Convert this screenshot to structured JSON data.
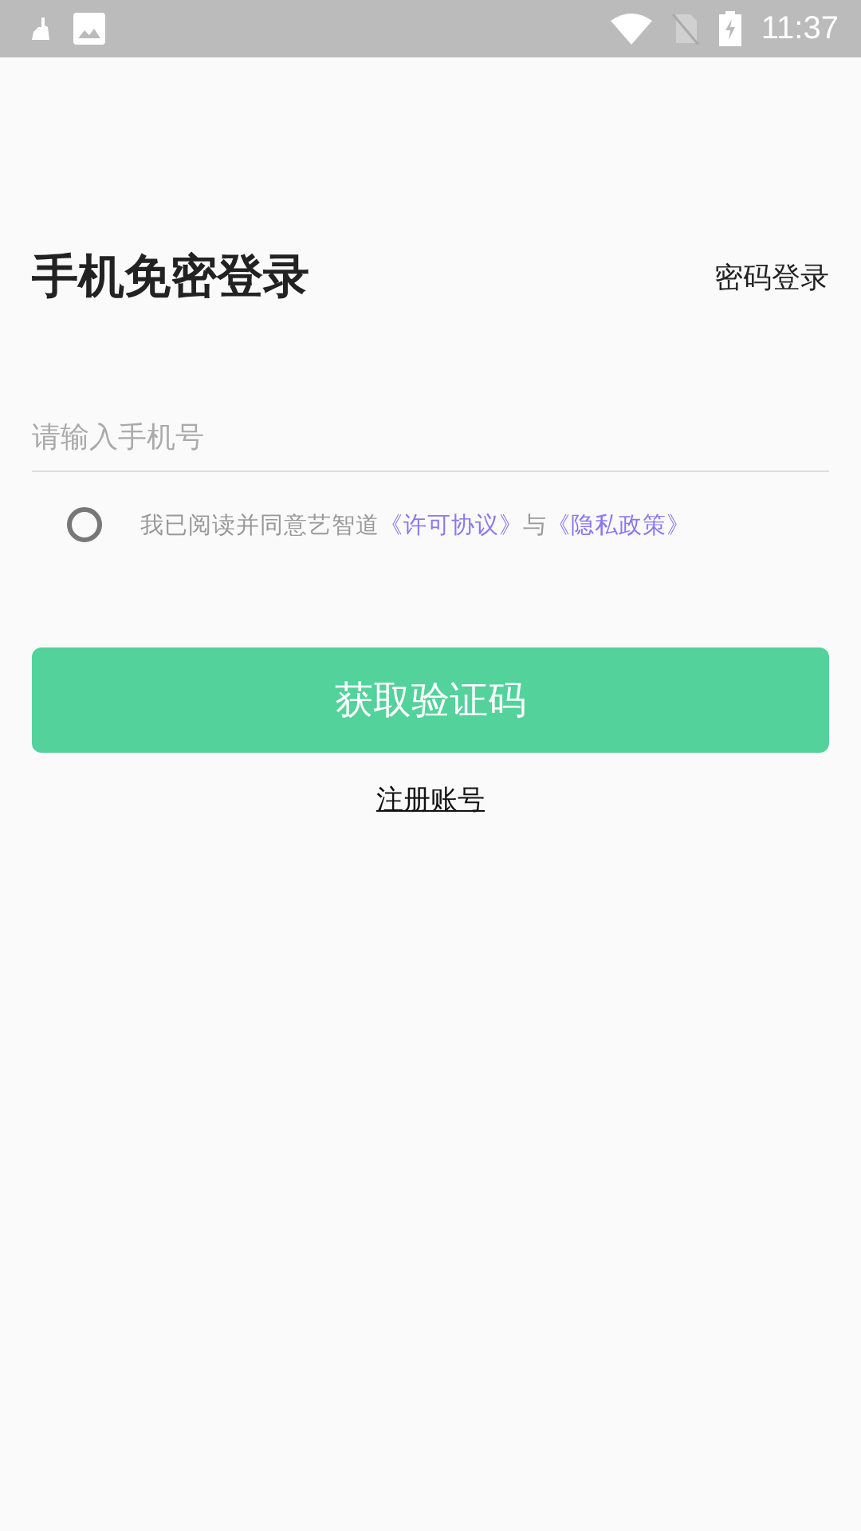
{
  "status_bar": {
    "time": "11:37"
  },
  "title": "手机免密登录",
  "password_login": "密码登录",
  "phone_field": {
    "placeholder": "请输入手机号"
  },
  "agreement": {
    "checked": false,
    "parts": [
      {
        "kind": "text",
        "text": "我已阅读并同意艺智道"
      },
      {
        "kind": "link",
        "text": "《许可协议》"
      },
      {
        "kind": "text",
        "text": "与"
      },
      {
        "kind": "link",
        "text": "《隐私政策》"
      }
    ]
  },
  "submit_button": "获取验证码",
  "register_link": "注册账号"
}
